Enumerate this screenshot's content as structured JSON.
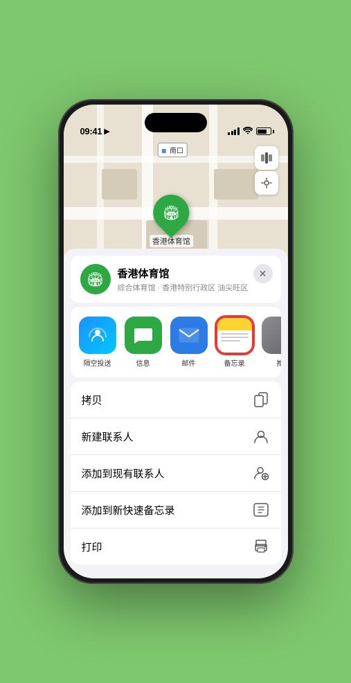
{
  "status_bar": {
    "time": "09:41",
    "location_arrow": "▶"
  },
  "map": {
    "south_entrance_label": "南口",
    "venue_pin_label": "香港体育馆"
  },
  "venue_card": {
    "name": "香港体育馆",
    "subtitle": "综合体育馆 · 香港特别行政区 油尖旺区",
    "close_label": "×"
  },
  "share_items": [
    {
      "id": "airdrop",
      "label": "隔空投送",
      "icon": "📡"
    },
    {
      "id": "messages",
      "label": "信息",
      "icon": "💬"
    },
    {
      "id": "mail",
      "label": "邮件",
      "icon": "✉️"
    },
    {
      "id": "notes",
      "label": "备忘录",
      "icon": ""
    },
    {
      "id": "more",
      "label": "推",
      "icon": "···"
    }
  ],
  "action_items": [
    {
      "id": "copy",
      "label": "拷贝",
      "icon": "⧉"
    },
    {
      "id": "new-contact",
      "label": "新建联系人",
      "icon": "👤"
    },
    {
      "id": "add-existing",
      "label": "添加到现有联系人",
      "icon": "👤"
    },
    {
      "id": "add-notes",
      "label": "添加到新快速备忘录",
      "icon": "⊡"
    },
    {
      "id": "print",
      "label": "打印",
      "icon": "🖨"
    }
  ],
  "colors": {
    "green": "#2da843",
    "accent_red": "#e53935",
    "bg_green": "#7ec86e"
  }
}
